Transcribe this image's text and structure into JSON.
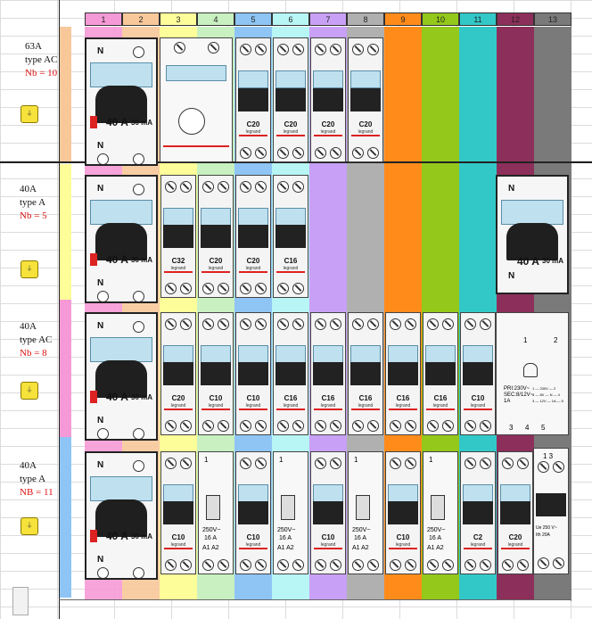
{
  "columns": [
    "1",
    "2",
    "3",
    "4",
    "5",
    "6",
    "7",
    "8",
    "9",
    "10",
    "11",
    "12",
    "13"
  ],
  "column_colors": [
    "#f59ad6",
    "#f8c89a",
    "#fdfd9a",
    "#c8f0c0",
    "#8ec5f5",
    "#b8f5f5",
    "#c8a0f5",
    "#b0b0b0",
    "#ff8c1a",
    "#94c81a",
    "#33c8c8",
    "#8c2f5a",
    "#7a7a7a"
  ],
  "rows": [
    {
      "rating": "63A",
      "type": "type AC",
      "nb": "Nb = 10",
      "rcd_amp": "40 A",
      "rcd_ma": "30 mA"
    },
    {
      "rating": "40A",
      "type": "type A",
      "nb": "Nb = 5",
      "rcd_amp": "40 A",
      "rcd_ma": "30 mA"
    },
    {
      "rating": "40A",
      "type": "type AC",
      "nb": "Nb = 8",
      "rcd_amp": "40 A",
      "rcd_ma": "30 mA"
    },
    {
      "rating": "40A",
      "type": "type A",
      "nb": "NB = 11",
      "rcd_amp": "40 A",
      "rcd_ma": "30 mA"
    }
  ],
  "rcd_n_label": "N",
  "row1_breakers": [
    "C20",
    "C20",
    "C20",
    "C20"
  ],
  "row2_breakers": [
    "C32",
    "C20",
    "C20",
    "C16"
  ],
  "row3_breakers": [
    "C20",
    "C10",
    "C10",
    "C16",
    "C16",
    "C16",
    "C16",
    "C16",
    "C10"
  ],
  "row4_breakers": [
    "C10",
    "C10",
    "C10",
    "C10",
    "C2",
    "C20"
  ],
  "row4_switch": {
    "rating": "250V~",
    "current": "16 A",
    "terms": "A1 A2",
    "top": "1"
  },
  "row4_last": {
    "top": "1 3",
    "rating": "Ue 250 V~",
    "current": "Ith 20A"
  },
  "row3_relay": {
    "t1": "1",
    "t2": "2",
    "line1": "PRI:230V~",
    "line2": "SEC:8/12V~",
    "line3": "1A",
    "line4": "1 — 230V — 2",
    "line5": "3 — 8V — N — 4",
    "line6": "3 — 12V — 1A — 5",
    "b3": "3",
    "b4": "4",
    "b5": "5"
  },
  "brand_text": "legrand",
  "tag_text": "⏚"
}
